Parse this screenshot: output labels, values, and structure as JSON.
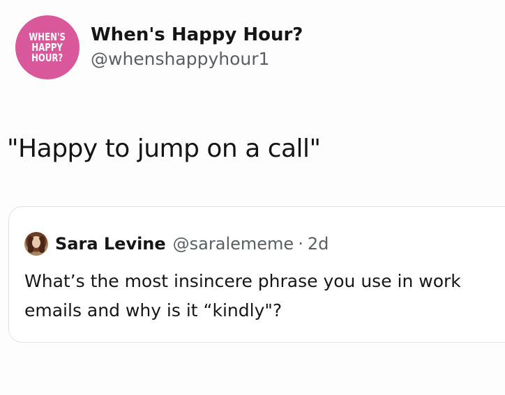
{
  "tweet": {
    "author": {
      "avatar_text": "WHEN'S\nHAPPY\nHOUR?",
      "avatar_color": "#d9579b",
      "display_name": "When's Happy Hour?",
      "handle": "@whenshappyhour1"
    },
    "text": "\"Happy to jump on a call\""
  },
  "quoted_tweet": {
    "author": {
      "display_name": "Sara Levine",
      "handle": "@saralememe",
      "separator": "·",
      "time": "2d"
    },
    "text": "What’s the most insincere phrase you use in work emails and why is it “kindly\"?"
  }
}
